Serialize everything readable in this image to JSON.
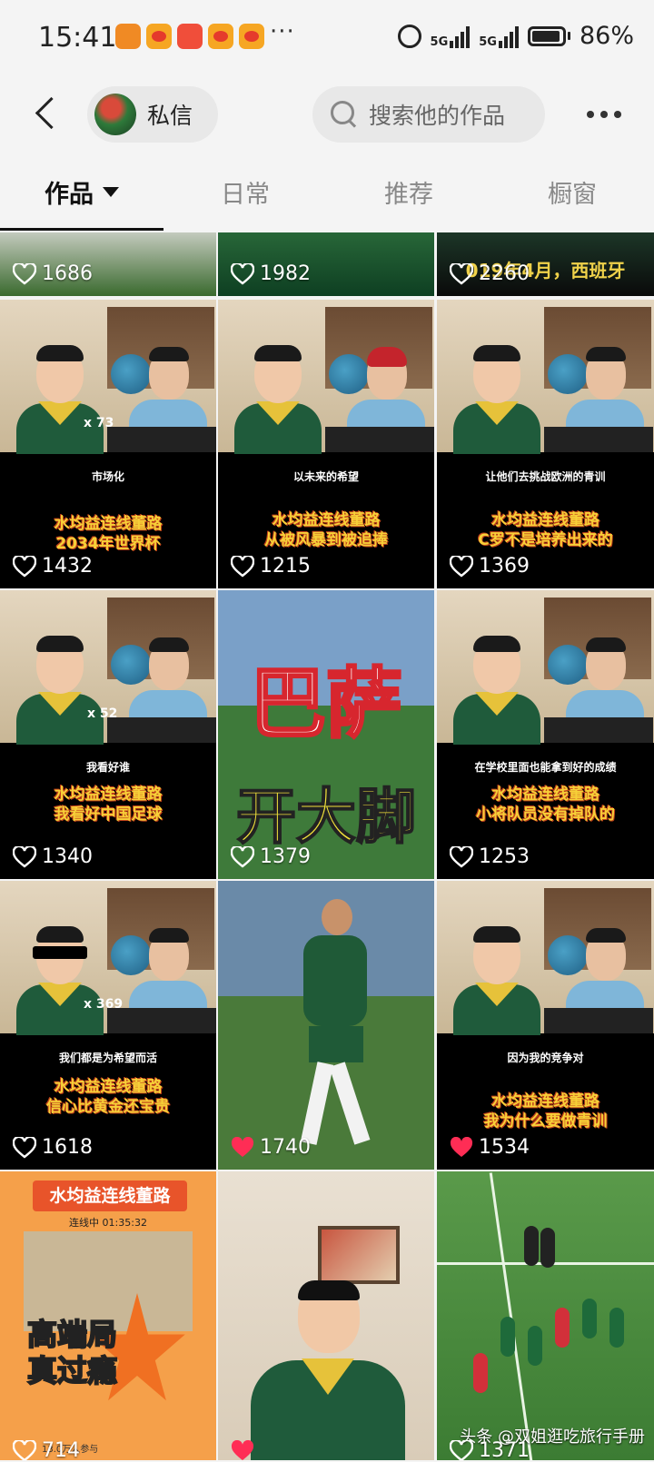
{
  "status": {
    "time": "15:41",
    "more": "···",
    "battery_pct": "86%",
    "signal1": "5G",
    "signal2": "5G"
  },
  "header": {
    "dm_label": "私信",
    "search_placeholder": "搜索他的作品"
  },
  "tabs": [
    {
      "label": "作品"
    },
    {
      "label": "日常"
    },
    {
      "label": "推荐"
    },
    {
      "label": "橱窗"
    }
  ],
  "videos": [
    {
      "likes": "1686"
    },
    {
      "likes": "1982"
    },
    {
      "likes": "2260",
      "overlay": "019年4月，西班牙"
    },
    {
      "likes": "1432",
      "top": "市场化",
      "title1": "水均益连线董路",
      "title2": "2034年世界杯",
      "badge_count": "x 73"
    },
    {
      "likes": "1215",
      "top": "以未来的希望",
      "title1": "水均益连线董路",
      "title2": "从被风暴到被追捧"
    },
    {
      "likes": "1369",
      "top": "让他们去挑战欧洲的青训",
      "title1": "水均益连线董路",
      "title2": "C罗不是培养出来的"
    },
    {
      "likes": "1340",
      "top": "我看好谁",
      "title1": "水均益连线董路",
      "title2": "我看好中国足球",
      "badge_count": "x 52"
    },
    {
      "likes": "1379",
      "big1": "巴萨",
      "big2": "开大脚"
    },
    {
      "likes": "1253",
      "top": "在学校里面也能拿到好的成绩",
      "title1": "水均益连线董路",
      "title2": "小将队员没有掉队的"
    },
    {
      "likes": "1618",
      "top": "我们都是为希望而活",
      "title1": "水均益连线董路",
      "title2": "信心比黄金还宝贵",
      "badge_count": "x 369"
    },
    {
      "likes": "1740"
    },
    {
      "likes": "1534",
      "top": "因为我的竞争对",
      "title1": "水均益连线董路",
      "title2": "我为什么要做青训"
    },
    {
      "likes": "714",
      "head": "水均益连线董路",
      "sub": "连线中 01:35:32",
      "big1": "高端局",
      "big2": "真过瘾",
      "foot": "13.0万人参与"
    },
    {
      "likes": ""
    },
    {
      "likes": "1371",
      "watermark": "头条 @双姐逛吃旅行手册"
    }
  ],
  "colors": {
    "heart_liked": "#ff2d55",
    "caption_yellow": "#f7d038"
  }
}
